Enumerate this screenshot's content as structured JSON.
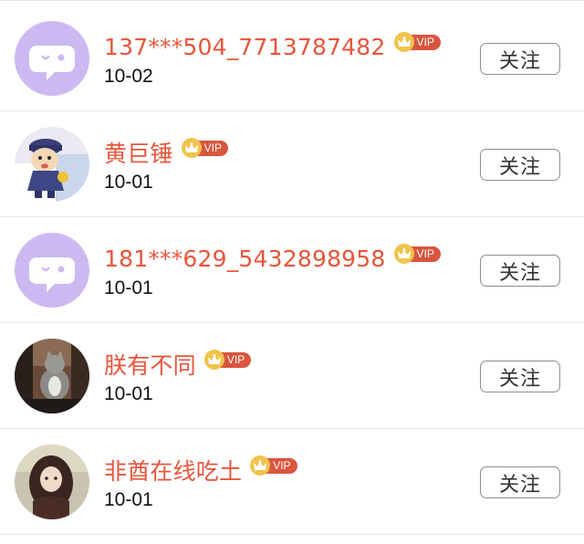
{
  "users": [
    {
      "name": "137***504_7713787482",
      "badge": "VIP",
      "date": "10-02",
      "follow_label": "关注",
      "avatar": "default-chat-avatar"
    },
    {
      "name": "黄巨锤",
      "badge": "VIP",
      "date": "10-01",
      "follow_label": "关注",
      "avatar": "cartoon-boy-avatar"
    },
    {
      "name": "181***629_5432898958",
      "badge": "VIP",
      "date": "10-01",
      "follow_label": "关注",
      "avatar": "default-chat-avatar"
    },
    {
      "name": "朕有不同",
      "badge": "VIP",
      "date": "10-01",
      "follow_label": "关注",
      "avatar": "cat-photo-avatar"
    },
    {
      "name": "非酋在线吃土",
      "badge": "VIP",
      "date": "10-01",
      "follow_label": "关注",
      "avatar": "doll-photo-avatar"
    }
  ],
  "colors": {
    "name": "#e8553b",
    "vip_tag": "#d9553e",
    "vip_crown": "#f0c34a",
    "default_avatar_bg": "#cdb9f2"
  }
}
